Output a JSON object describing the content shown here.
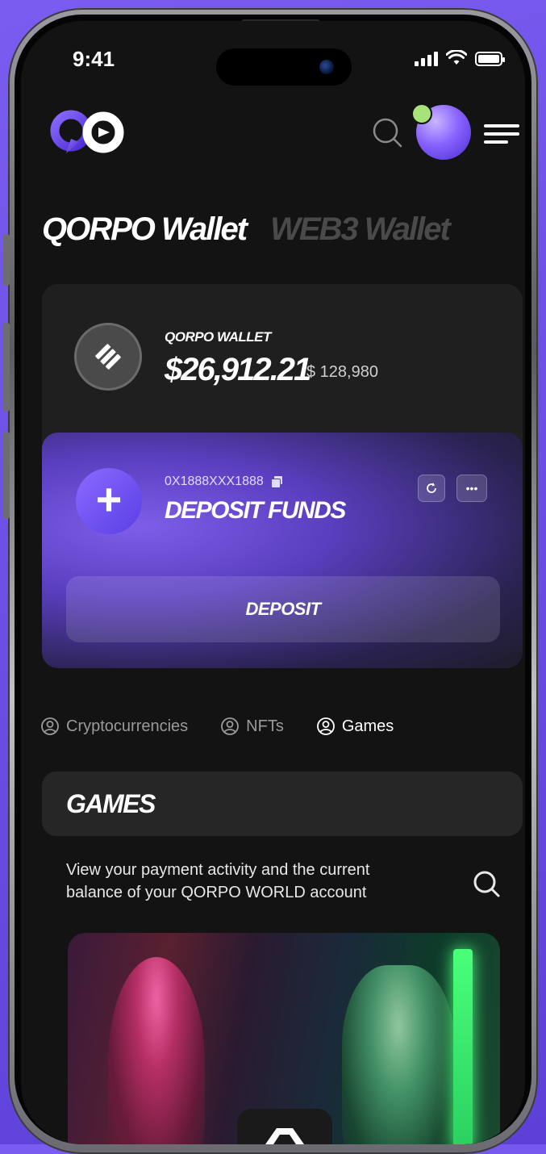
{
  "status_bar": {
    "time": "9:41"
  },
  "wallet_tabs": [
    {
      "label": "QORPO Wallet",
      "active": true
    },
    {
      "label": "WEB3 Wallet",
      "active": false
    }
  ],
  "wallet": {
    "label": "QORPO WALLET",
    "balance": "$26,912.21",
    "secondary_balance": "$ 128,980"
  },
  "deposit": {
    "address": "0X1888XXX1888",
    "title": "DEPOSIT FUNDS",
    "button_label": "DEPOSIT"
  },
  "asset_tabs": [
    {
      "label": "Cryptocurrencies",
      "active": false
    },
    {
      "label": "NFTs",
      "active": false
    },
    {
      "label": "Games",
      "active": true
    }
  ],
  "games": {
    "title": "GAMES",
    "description": "View your payment activity and the current balance of your QORPO WORLD account"
  },
  "colors": {
    "accent": "#7c5cf0",
    "background": "#131313",
    "card": "#1f1f1f",
    "avatar_status": "#a8e27a"
  },
  "icons": [
    "qorpo-logo-icon",
    "search-icon",
    "menu-icon",
    "coin-icon",
    "plus-icon",
    "copy-icon",
    "refresh-icon",
    "more-icon",
    "user-circle-icon"
  ]
}
